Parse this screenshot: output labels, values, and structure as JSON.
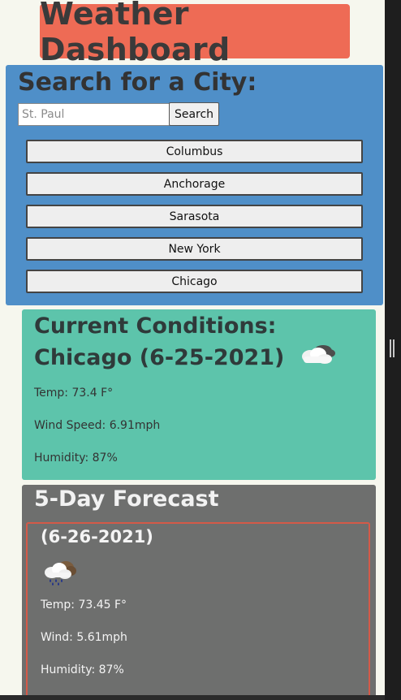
{
  "header": {
    "title": "Weather Dashboard"
  },
  "search": {
    "heading": "Search for a City:",
    "placeholder": "St. Paul",
    "button_label": "Search",
    "history": [
      "Columbus",
      "Anchorage",
      "Sarasota",
      "New York",
      "Chicago"
    ]
  },
  "current": {
    "heading": "Current Conditions: Chicago (6-25-2021)",
    "icon": "partly-cloudy-icon",
    "temp": "Temp: 73.4 F°",
    "wind": "Wind Speed: 6.91mph",
    "humidity": "Humidity: 87%"
  },
  "forecast": {
    "heading": "5-Day Forecast",
    "days": [
      {
        "date": "(6-26-2021)",
        "icon": "rain-cloud-icon",
        "temp": "Temp: 73.45 F°",
        "wind": "Wind: 5.61mph",
        "humidity": "Humidity: 87%"
      }
    ]
  },
  "colors": {
    "header_bg": "#ee6b55",
    "search_panel_bg": "#4f8fc8",
    "current_panel_bg": "#5dc4ab",
    "forecast_panel_bg": "#6e6f6e",
    "forecast_card_border": "#d45a48",
    "page_bg": "#f6f7ee"
  }
}
